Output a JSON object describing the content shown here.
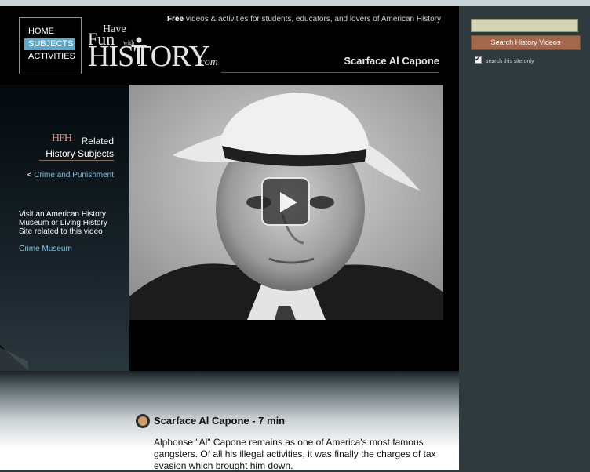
{
  "nav": {
    "items": [
      {
        "label": "HOME",
        "active": false
      },
      {
        "label": "SUBJECTS",
        "active": true
      },
      {
        "label": "ACTIVITIES",
        "active": false
      }
    ]
  },
  "logo": {
    "have": "Have",
    "fun": "Fun",
    "with": "with",
    "history": "HISTORY",
    "com": ".com"
  },
  "header": {
    "tagline_bold": "Free",
    "tagline_rest": " videos & activities for students, educators, and lovers of American History",
    "video_title": "Scarface Al Capone"
  },
  "left_panel": {
    "brand_mark": "HFH",
    "related_title_line1": "Related",
    "related_title_line2": "History Subjects",
    "crime_link_prefix": "<",
    "crime_link": "Crime and Punishment",
    "visit_text": "Visit an American History Museum or Living History Site related to this video",
    "museum_link": "Crime Museum"
  },
  "content": {
    "clip_title": "Scarface Al Capone - 7 min",
    "description": "Alphonse \"Al\" Capone remains as one of America's most famous gangsters. Of all his illegal activities, it was finally the charges of tax evasion which brought him down."
  },
  "search": {
    "input_value": "",
    "button_label": "Search History Videos",
    "checkbox_label": "search this site only",
    "checkbox_checked": true
  },
  "colors": {
    "accent_blue": "#5ea7c9",
    "link_blue": "#7fc1de",
    "search_button": "#a3684c",
    "sidebar_bg": "#2f3a3e"
  }
}
